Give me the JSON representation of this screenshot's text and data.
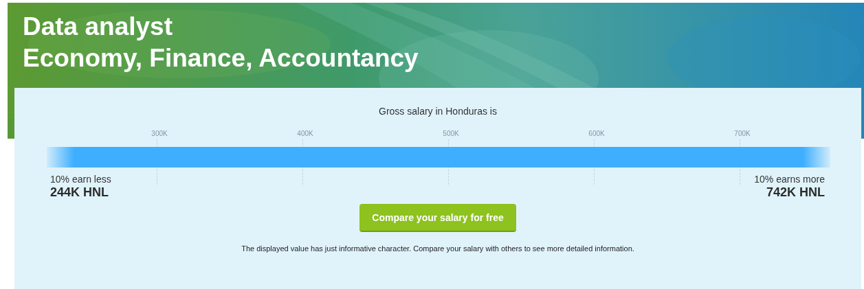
{
  "header": {
    "title": "Data analyst",
    "subtitle": "Economy, Finance, Accountancy"
  },
  "salary": {
    "heading": "Gross salary in Honduras is",
    "ticks": [
      "300K",
      "400K",
      "500K",
      "600K",
      "700K"
    ],
    "low": {
      "caption": "10% earn less",
      "value": "244K HNL"
    },
    "high": {
      "caption": "10% earns more",
      "value": "742K HNL"
    },
    "button": "Compare your salary for free",
    "note": "The displayed value has just informative character. Compare your salary with others to see more detailed information."
  }
}
